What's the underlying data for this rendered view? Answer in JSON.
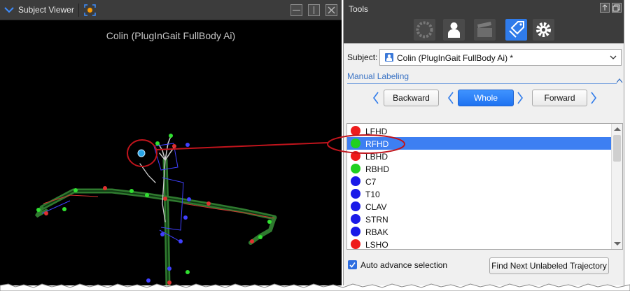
{
  "viewer": {
    "title": "Subject Viewer",
    "subject_caption": "Colin (PlugInGait FullBody Ai)"
  },
  "tools": {
    "title": "Tools",
    "tab_icons": [
      "circle-grid-icon",
      "person-icon",
      "clapperboard-icon",
      "label-tag-icon",
      "gear-icon"
    ],
    "subject_label": "Subject:",
    "subject_value": "Colin (PlugInGait FullBody Ai) *",
    "section_title": "Manual Labeling",
    "nav": {
      "backward": "Backward",
      "whole": "Whole",
      "forward": "Forward"
    },
    "markers": [
      {
        "name": "LFHD",
        "color": "#ee1c1c"
      },
      {
        "name": "RFHD",
        "color": "#20d020"
      },
      {
        "name": "LBHD",
        "color": "#ee1c1c"
      },
      {
        "name": "RBHD",
        "color": "#20d020"
      },
      {
        "name": "C7",
        "color": "#1a1ae8"
      },
      {
        "name": "T10",
        "color": "#1a1ae8"
      },
      {
        "name": "CLAV",
        "color": "#1a1ae8"
      },
      {
        "name": "STRN",
        "color": "#1a1ae8"
      },
      {
        "name": "RBAK",
        "color": "#1a1ae8"
      },
      {
        "name": "LSHO",
        "color": "#ee1c1c"
      }
    ],
    "selected_marker": "RFHD",
    "auto_advance_label": "Auto advance selection",
    "auto_advance_checked": true,
    "find_button": "Find Next Unlabeled Trajectory"
  },
  "colors": {
    "accent": "#3d7ff2",
    "annotation": "#c0141c",
    "viewport_bg": "#000000"
  }
}
